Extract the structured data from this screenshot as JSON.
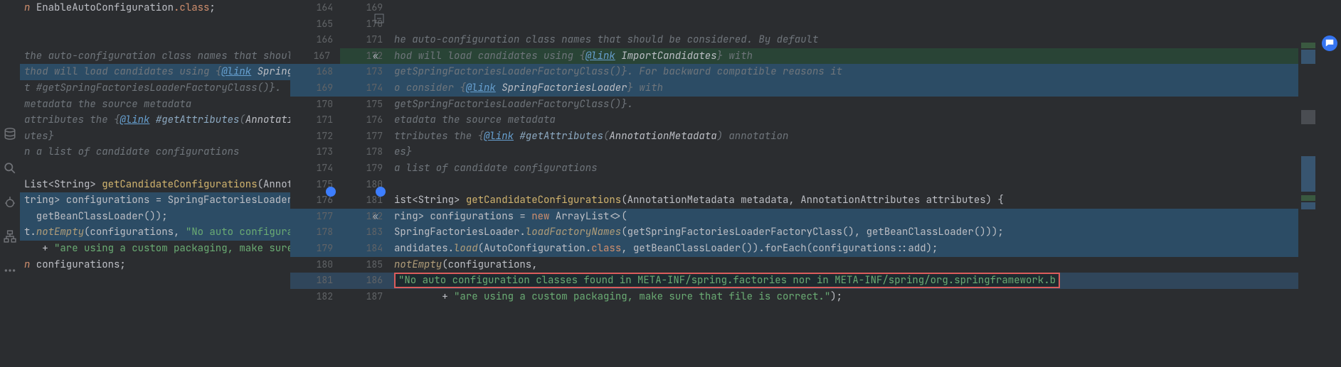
{
  "chat_icon_label": "chat",
  "left": {
    "1": "n EnableAutoConfiguration.class;",
    "2": "",
    "3": "",
    "4": " the auto-configuration class names that shoul",
    "5": "thod will load candidates using {@link Spring",
    "5_link": "@link",
    "5_class": "Spring",
    "6": "t #getSpringFactoriesLoaderFactoryClass()}.",
    "7": " metadata the source metadata",
    "8": " attributes the {@link #getAttributes(Annotati",
    "8_link": "@link",
    "8_method": "#getAttributes",
    "8_type": "Annotati",
    "9": "utes}",
    "10": "n a list of candidate configurations",
    "11": "",
    "12": "List<String> getCandidateConfigurations(Annot",
    "12_method": "getCandidateConfigurations",
    "13": "tring> configurations = SpringFactoriesLoader",
    "14": "  getBeanClassLoader());",
    "15": "t.notEmpty(configurations, \"No auto configura",
    "15_mtd": "notEmpty",
    "15_str": "\"No auto configura",
    "16": "+ \"are using a custom packaging, make sure",
    "16_str": "\"are using a custom packaging, make sure",
    "17": "n configurations;",
    "18": ""
  },
  "gutter_left": [
    "164",
    "165",
    "166",
    "167",
    "168",
    "169",
    "170",
    "171",
    "172",
    "173",
    "174",
    "175",
    "176",
    "177",
    "178",
    "179",
    "180",
    "181",
    "182"
  ],
  "gutter_right": [
    "169",
    "170",
    "171",
    "172",
    "173",
    "174",
    "175",
    "176",
    "177",
    "178",
    "179",
    "180",
    "181",
    "182",
    "183",
    "184",
    "185",
    "186",
    "187"
  ],
  "right": {
    "1": "",
    "2": "",
    "3": "he auto-configuration class names that should be considered. By default",
    "4a": "hod will load candidates using {",
    "4b": "@link",
    "4c": " ImportCandidates",
    "4d": "} with",
    "5a": "getSpringFactoriesLoaderFactoryClass()}. For backward compatible reasons it",
    "6a": "o consider {",
    "6b": "@link",
    "6c": " SpringFactoriesLoader",
    "6d": "} with",
    "7": "getSpringFactoriesLoaderFactoryClass()}.",
    "8": "etadata the source metadata",
    "9a": "ttributes the {",
    "9b": "@link",
    "9c": " #getAttributes",
    "9d": "(",
    "9e": "AnnotationMetadata",
    "9f": ") annotation",
    "10": "es}",
    "11": "a list of candidate configurations",
    "12": "",
    "13a": "ist<String> ",
    "13b": "getCandidateConfigurations",
    "13c": "(AnnotationMetadata metadata, AnnotationAttributes attributes) {",
    "14a": "ring> configurations = ",
    "14b": "new",
    "14c": " ArrayList<>(",
    "15a": " SpringFactoriesLoader.",
    "15b": "loadFactoryNames",
    "15c": "(getSpringFactoriesLoaderFactoryClass(), getBeanClassLoader()));",
    "16a": "andidates.",
    "16b": "load",
    "16c": "(",
    "16d": "AutoConfiguration",
    "16e": ".",
    "16f": "class",
    "16g": ", getBeanClassLoader()).forEach(configurations::add);",
    "17a": "notEmpty",
    "17b": "(configurations,",
    "18_changed": "\"No auto configuration classes found in META-INF/spring.factories nor in META-INF/spring/org.springframework.b",
    "19a": "+ ",
    "19b": "\"are using a custom packaging, make sure that file is correct.\"",
    "19c": ");"
  },
  "colors": {
    "diff_insert": "#294436",
    "diff_modify": "#2c4c65",
    "highlight_border": "#db5c5c"
  }
}
